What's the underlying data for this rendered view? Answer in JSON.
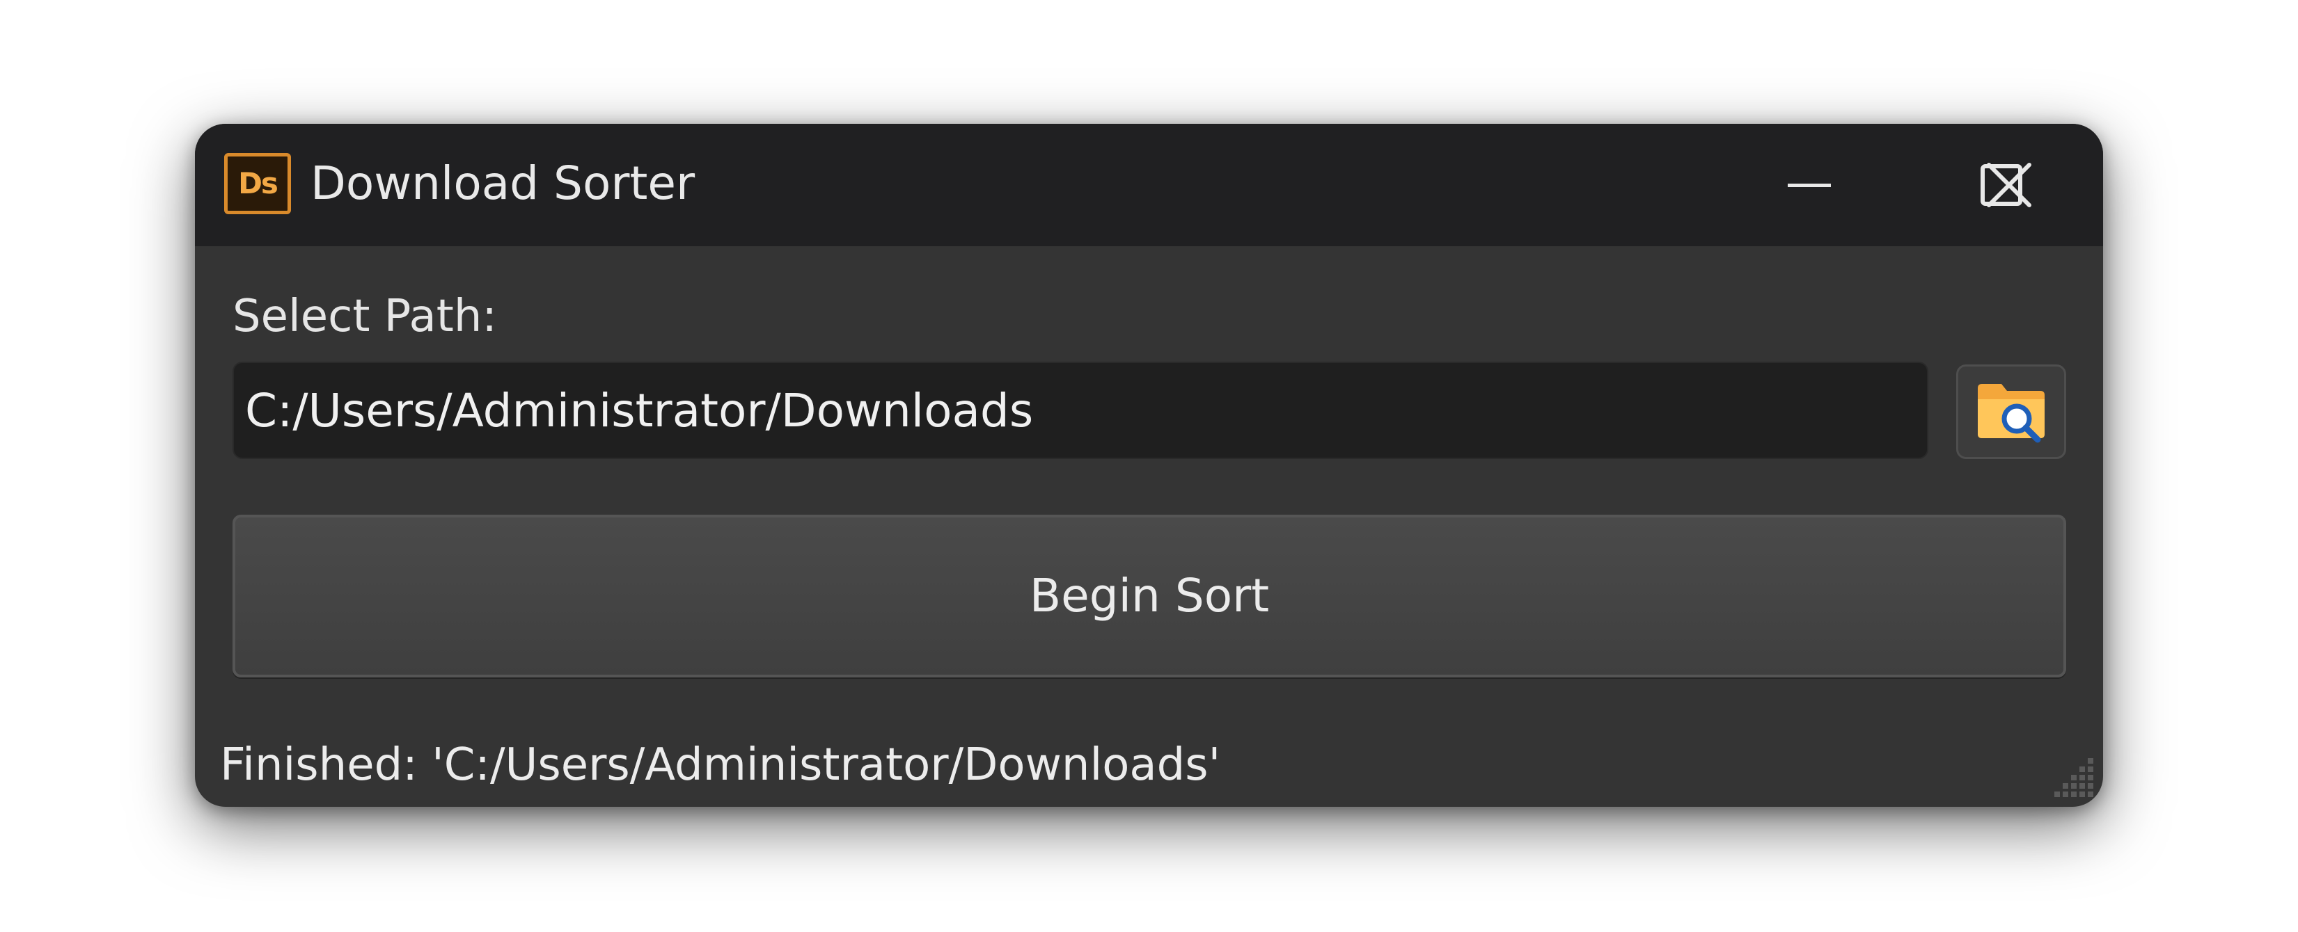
{
  "window": {
    "title": "Download Sorter",
    "app_icon_text": "Ds",
    "app_icon": "ds-app-icon",
    "controls": {
      "minimize_icon": "minimize-icon",
      "maximize_icon": "maximize-icon",
      "close_icon": "close-icon"
    }
  },
  "form": {
    "path_label": "Select Path:",
    "path_value": "C:/Users/Administrator/Downloads",
    "browse_icon": "folder-search-icon",
    "sort_button_label": "Begin Sort"
  },
  "status": {
    "text": "Finished: 'C:/Users/Administrator/Downloads'"
  },
  "colors": {
    "titlebar": "#202022",
    "body": "#343434",
    "input_bg": "#1f1f1f",
    "accent_orange": "#f2a845",
    "text": "#e9e9e9"
  }
}
